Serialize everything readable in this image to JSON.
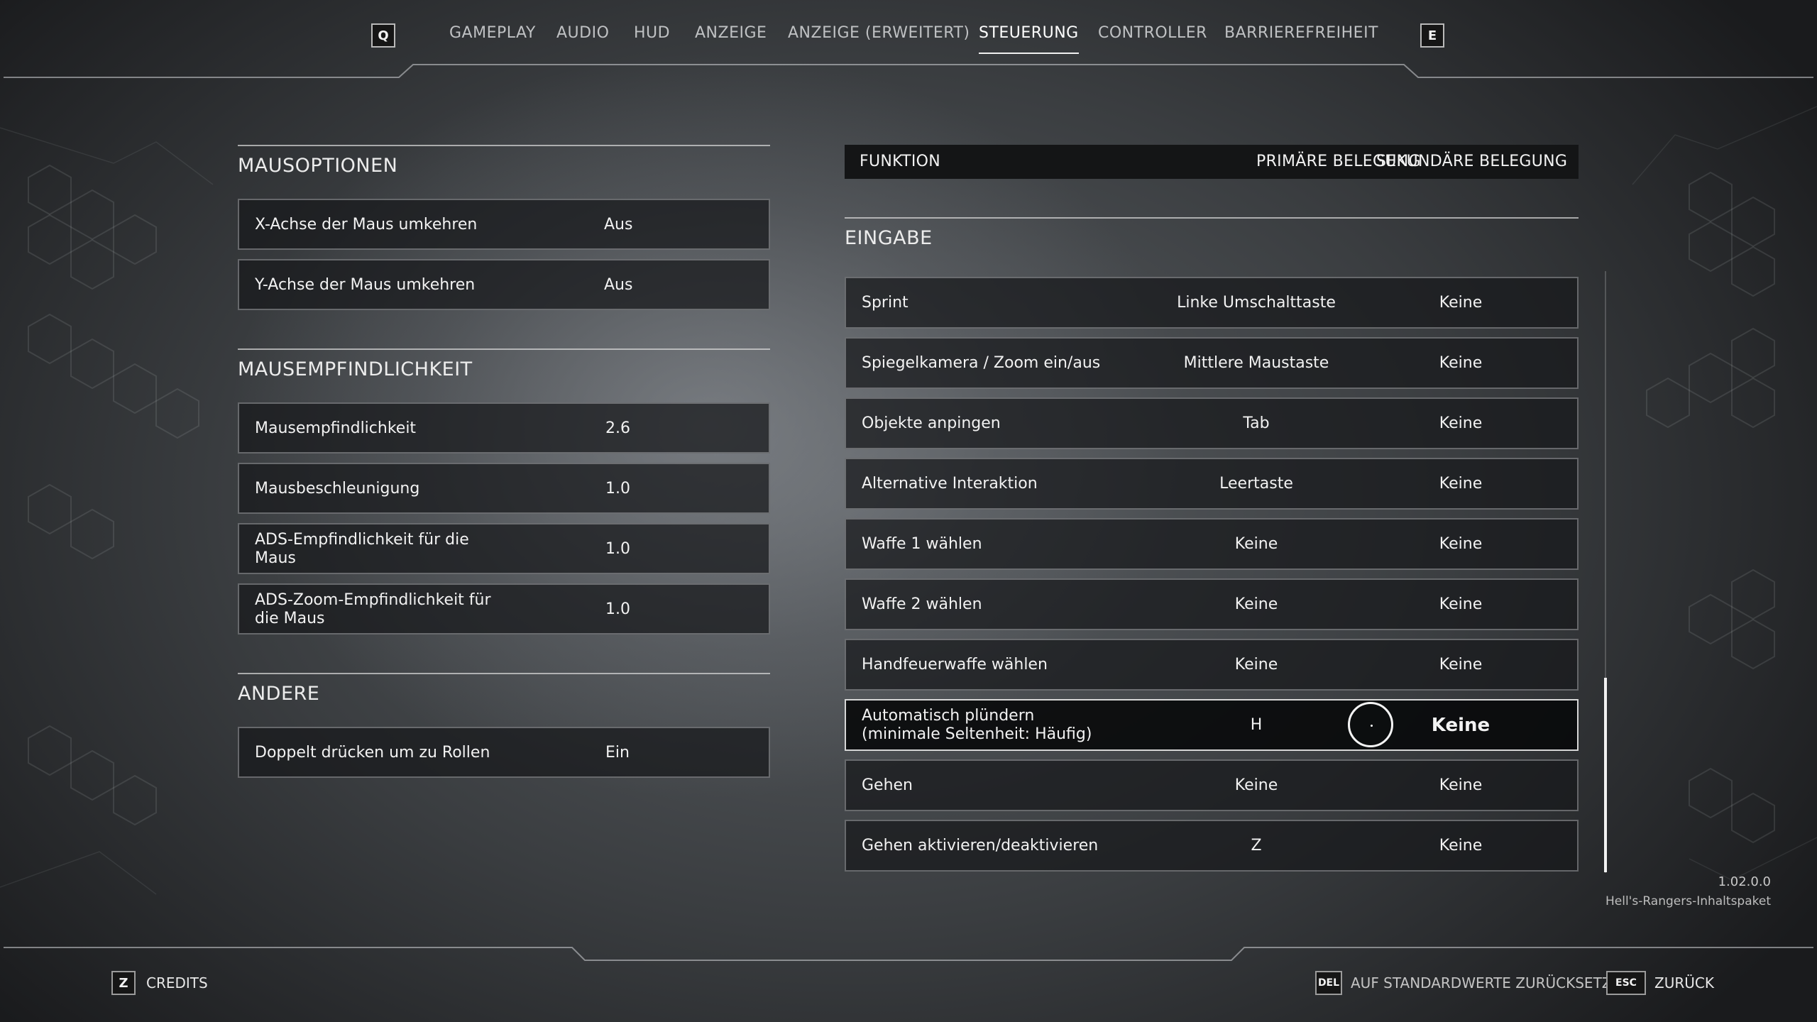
{
  "nav": {
    "prev_key": "Q",
    "next_key": "E",
    "tabs": [
      {
        "label": "GAMEPLAY",
        "active": false
      },
      {
        "label": "AUDIO",
        "active": false
      },
      {
        "label": "HUD",
        "active": false
      },
      {
        "label": "ANZEIGE",
        "active": false
      },
      {
        "label": "ANZEIGE (ERWEITERT)",
        "active": false
      },
      {
        "label": "STEUERUNG",
        "active": true
      },
      {
        "label": "CONTROLLER",
        "active": false
      },
      {
        "label": "BARRIEREFREIHEIT",
        "active": false
      }
    ]
  },
  "left": {
    "mouse_options": {
      "title": "MAUSOPTIONEN",
      "rows": [
        {
          "label": "X-Achse der Maus umkehren",
          "value": "Aus"
        },
        {
          "label": "Y-Achse der Maus umkehren",
          "value": "Aus"
        }
      ]
    },
    "mouse_sensitivity": {
      "title": "MAUSEMPFINDLICHKEIT",
      "rows": [
        {
          "label": "Mausempfindlichkeit",
          "value": "2.6"
        },
        {
          "label": "Mausbeschleunigung",
          "value": "1.0"
        },
        {
          "label": "ADS-Empfindlichkeit für die",
          "label2": "Maus",
          "value": "1.0"
        },
        {
          "label": "ADS-Zoom-Empfindlichkeit für",
          "label2": "die Maus",
          "value": "1.0"
        }
      ]
    },
    "other": {
      "title": "ANDERE",
      "rows": [
        {
          "label": "Doppelt drücken um zu Rollen",
          "value": "Ein"
        }
      ]
    }
  },
  "right": {
    "header": {
      "function": "FUNKTION",
      "primary": "PRIMÄRE BELEGUNG",
      "secondary": "SEKUNDÄRE BELEGUNG"
    },
    "section_title": "EINGABE",
    "rows": [
      {
        "label": "Sprint",
        "primary": "Linke Umschalttaste",
        "secondary": "Keine"
      },
      {
        "label": "Spiegelkamera / Zoom ein/aus",
        "primary": "Mittlere Maustaste",
        "secondary": "Keine"
      },
      {
        "label": "Objekte anpingen",
        "primary": "Tab",
        "secondary": "Keine"
      },
      {
        "label": "Alternative Interaktion",
        "primary": "Leertaste",
        "secondary": "Keine"
      },
      {
        "label": "Waffe 1 wählen",
        "primary": "Keine",
        "secondary": "Keine"
      },
      {
        "label": "Waffe 2 wählen",
        "primary": "Keine",
        "secondary": "Keine"
      },
      {
        "label": "Handfeuerwaffe wählen",
        "primary": "Keine",
        "secondary": "Keine"
      },
      {
        "label": "Automatisch plündern",
        "label2": "(minimale Seltenheit: Häufig)",
        "primary": "H",
        "secondary": "Keine",
        "highlighted": true
      },
      {
        "label": "Gehen",
        "primary": "Keine",
        "secondary": "Keine"
      },
      {
        "label": "Gehen aktivieren/deaktivieren",
        "primary": "Z",
        "secondary": "Keine"
      }
    ],
    "scroll_position": 0.68
  },
  "footer": {
    "version": "1.02.0.0",
    "dlc": "Hell's-Rangers-Inhaltspaket",
    "credits_key": "Z",
    "credits_label": "CREDITS",
    "reset_key": "DEL",
    "reset_label": "AUF STANDARDWERTE ZURÜCKSETZEN",
    "back_key": "ESC",
    "back_label": "ZURÜCK"
  },
  "colors": {
    "background": "#3a3d40",
    "row_bg": "#16181a",
    "row_border": "#96989b",
    "highlight_border": "#d6d6d6",
    "text": "#f2f2f2"
  }
}
